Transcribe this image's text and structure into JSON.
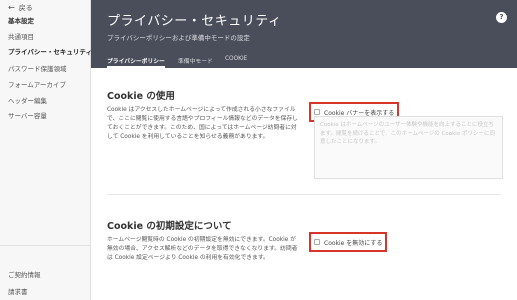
{
  "sidebar": {
    "back_label": "戻る",
    "items": [
      {
        "label": "基本設定",
        "type": "heading"
      },
      {
        "label": "共通項目",
        "type": "item"
      },
      {
        "label": "プライバシー・セキュリティ",
        "type": "active"
      },
      {
        "label": "パスワード保護領域",
        "type": "item"
      },
      {
        "label": "フォームアーカイブ",
        "type": "item"
      },
      {
        "label": "ヘッダー編集",
        "type": "item"
      },
      {
        "label": "サーバー容量",
        "type": "item"
      }
    ],
    "footer_items": [
      {
        "label": "ご契約情報"
      },
      {
        "label": "請求書"
      }
    ]
  },
  "header": {
    "title": "プライバシー・セキュリティ",
    "subtitle": "プライバシーポリシーおよび準備中モードの設定",
    "help_label": "?",
    "tabs": [
      {
        "label": "プライバシーポリシー",
        "active": true
      },
      {
        "label": "準備中モード",
        "active": false
      },
      {
        "label": "COOKIE",
        "active": false
      }
    ]
  },
  "main": {
    "cookie_usage": {
      "title": "Cookie の使用",
      "description": "Cookie はアクセスしたホームページによって作成される小さなファイルで、ここに閲覧に使用する言語やプロフィール情報などのデータを保存しておくことができます。このため、国によってはホームページ訪問者に対して Cookie を利用していることを知らせる義務があります。",
      "checkbox_label": "Cookie バナーを表示する",
      "checkbox_checked": false,
      "banner_placeholder": "Cookie はホームページのユーザー体験や機能を向上することに役立ちます。閲覧を続けることで、このホームページの Cookie ポリシーに同意したことになります。"
    },
    "cookie_default": {
      "title": "Cookie の初期設定について",
      "description": "ホームページ閲覧時の Cookie の初期設定を無効にできます。Cookie が無効の場合、アクセス解析などのデータを取得できなくなります。訪問者は Cookie 設定ページより Cookie の利用を有効化できます。",
      "checkbox_label": "Cookie を無効にする",
      "checkbox_checked": false
    }
  }
}
